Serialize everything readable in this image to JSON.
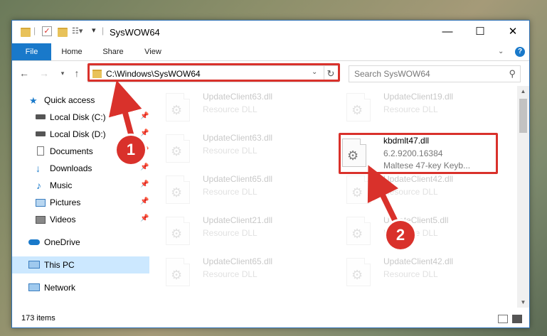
{
  "window": {
    "title": "SysWOW64",
    "controls": {
      "minimize": "—",
      "maximize": "☐",
      "close": "✕"
    }
  },
  "ribbon": {
    "tabs": [
      "File",
      "Home",
      "Share",
      "View"
    ],
    "help": "?"
  },
  "navbar": {
    "address": "C:\\Windows\\SysWOW64",
    "search_placeholder": "Search SysWOW64"
  },
  "sidebar": {
    "items": [
      {
        "label": "Quick access",
        "icon": "star-icon",
        "pinned": false
      },
      {
        "label": "Local Disk (C:)",
        "icon": "drive-icon",
        "pinned": true
      },
      {
        "label": "Local Disk (D:)",
        "icon": "drive-icon",
        "pinned": true
      },
      {
        "label": "Documents",
        "icon": "documents-icon",
        "pinned": true
      },
      {
        "label": "Downloads",
        "icon": "downloads-icon",
        "pinned": true
      },
      {
        "label": "Music",
        "icon": "music-icon",
        "pinned": true
      },
      {
        "label": "Pictures",
        "icon": "pictures-icon",
        "pinned": true
      },
      {
        "label": "Videos",
        "icon": "videos-icon",
        "pinned": true
      },
      {
        "label": "OneDrive",
        "icon": "cloud-icon",
        "pinned": false
      },
      {
        "label": "This PC",
        "icon": "computer-icon",
        "pinned": false,
        "selected": true
      },
      {
        "label": "Network",
        "icon": "network-icon",
        "pinned": false
      }
    ]
  },
  "files": {
    "left": [
      {
        "name": "UpdateClient63.dll",
        "type": "Resource DLL"
      },
      {
        "name": "UpdateClient63.dll",
        "type": "Resource DLL"
      },
      {
        "name": "UpdateClient65.dll",
        "type": "Resource DLL"
      },
      {
        "name": "UpdateClient21.dll",
        "type": "Resource DLL"
      },
      {
        "name": "UpdateClient65.dll",
        "type": "Resource DLL"
      }
    ],
    "right": [
      {
        "name": "UpdateClient19.dll",
        "type": "Resource DLL"
      },
      {
        "name": "kbdmlt47.dll",
        "version": "6.2.9200.16384",
        "type": "Maltese 47-key Keyb...",
        "highlighted": true
      },
      {
        "name": "UpdateClient42.dll",
        "type": "Resource DLL"
      },
      {
        "name": "UpdateClient5.dll",
        "type": "Resource DLL"
      },
      {
        "name": "UpdateClient42.dll",
        "type": "Resource DLL"
      }
    ]
  },
  "status": {
    "item_count": "173 items"
  },
  "annotations": {
    "step1": "1",
    "step2": "2",
    "color": "#d9312b"
  }
}
